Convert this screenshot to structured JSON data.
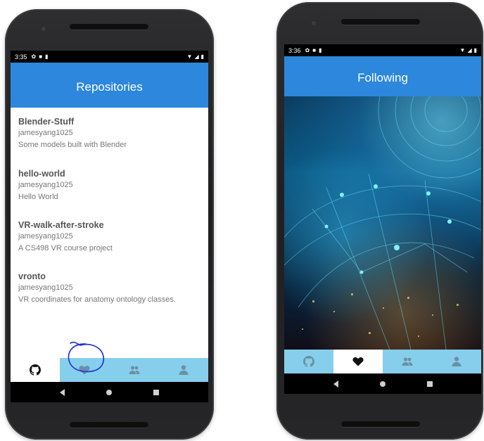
{
  "left_phone": {
    "status": {
      "time": "3:35"
    },
    "app_title": "Repositories",
    "repos": [
      {
        "name": "Blender-Stuff",
        "owner": "jamesyang1025",
        "description": "Some models built with Blender"
      },
      {
        "name": "hello-world",
        "owner": "jamesyang1025",
        "description": "Hello World"
      },
      {
        "name": "VR-walk-after-stroke",
        "owner": "jamesyang1025",
        "description": "A CS498 VR course project"
      },
      {
        "name": "vronto",
        "owner": "jamesyang1025",
        "description": "VR coordinates for anatomy ontology classes."
      }
    ],
    "tabs": [
      {
        "icon": "github-icon",
        "active": true
      },
      {
        "icon": "heart-icon",
        "active": false
      },
      {
        "icon": "people-icon",
        "active": false
      },
      {
        "icon": "person-icon",
        "active": false
      }
    ]
  },
  "right_phone": {
    "status": {
      "time": "3:36"
    },
    "app_title": "Following",
    "tabs": [
      {
        "icon": "github-icon",
        "active": false
      },
      {
        "icon": "heart-icon",
        "active": true
      },
      {
        "icon": "people-icon",
        "active": false
      },
      {
        "icon": "person-icon",
        "active": false
      }
    ]
  },
  "colors": {
    "app_bar": "#2c87dd",
    "bottom_nav": "#86cfec",
    "annotation": "#1a2fd6"
  }
}
